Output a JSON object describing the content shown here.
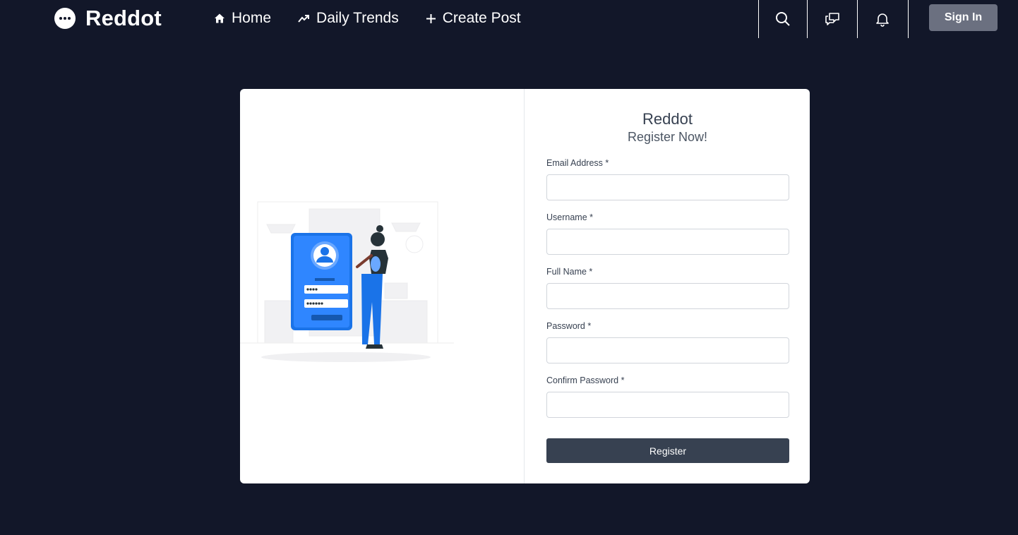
{
  "brand": {
    "name": "Reddot",
    "logo_icon": "chat-bubble-dots-icon"
  },
  "nav": {
    "links": [
      {
        "label": "Home",
        "icon": "home-icon"
      },
      {
        "label": "Daily Trends",
        "icon": "trending-up-icon"
      },
      {
        "label": "Create Post",
        "icon": "plus-icon"
      }
    ],
    "icons": [
      "search-icon",
      "chat-icon",
      "bell-icon"
    ],
    "signin_label": "Sign In"
  },
  "form": {
    "title": "Reddot",
    "subtitle": "Register Now!",
    "fields": [
      {
        "label": "Email Address *",
        "value": ""
      },
      {
        "label": "Username *",
        "value": ""
      },
      {
        "label": "Full Name *",
        "value": ""
      },
      {
        "label": "Password *",
        "value": ""
      },
      {
        "label": "Confirm Password *",
        "value": ""
      }
    ],
    "submit_label": "Register"
  },
  "colors": {
    "background": "#121729",
    "card": "#ffffff",
    "primary_button": "#374151",
    "signin_button": "#6b7080",
    "illustration_accent": "#1a73e8"
  }
}
